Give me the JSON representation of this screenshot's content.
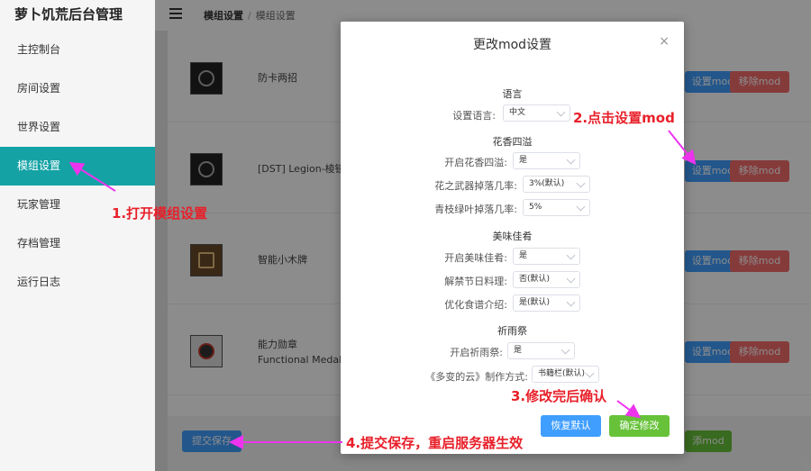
{
  "app": {
    "title": "萝卜饥荒后台管理"
  },
  "sidebar": {
    "items": [
      {
        "label": "主控制台",
        "active": false
      },
      {
        "label": "房间设置",
        "active": false
      },
      {
        "label": "世界设置",
        "active": false
      },
      {
        "label": "模组设置",
        "active": true
      },
      {
        "label": "玩家管理",
        "active": false
      },
      {
        "label": "存档管理",
        "active": false
      },
      {
        "label": "运行日志",
        "active": false
      }
    ]
  },
  "header": {
    "breadcrumb": [
      "模组设置",
      "模组设置"
    ],
    "separator": "/"
  },
  "mods": [
    {
      "name": "防卡两招",
      "set_label": "设置mod",
      "delete_label": "移除mod"
    },
    {
      "name": "[DST] Legion-棱镜",
      "set_label": "设置mod",
      "delete_label": "移除mod"
    },
    {
      "name": "智能小木牌",
      "set_label": "设置mod",
      "delete_label": "移除mod"
    },
    {
      "name": "能力勋章 Functional Medal",
      "set_label": "设置mod",
      "delete_label": "移除mod"
    }
  ],
  "footer": {
    "submit_label": "提交保存",
    "add_label": "添mod"
  },
  "dialog": {
    "title": "更改mod设置",
    "close_glyph": "×",
    "sections": [
      {
        "title": "语言",
        "fields": [
          {
            "label": "设置语言:",
            "value": "中文"
          }
        ]
      },
      {
        "title": "花香四溢",
        "fields": [
          {
            "label": "开启花香四溢:",
            "value": "是"
          },
          {
            "label": "花之武器掉落几率:",
            "value": "3%(默认)"
          },
          {
            "label": "青枝绿叶掉落几率:",
            "value": "5%"
          }
        ]
      },
      {
        "title": "美味佳肴",
        "fields": [
          {
            "label": "开启美味佳肴:",
            "value": "是"
          },
          {
            "label": "解禁节日料理:",
            "value": "否(默认)"
          },
          {
            "label": "优化食谱介绍:",
            "value": "是(默认)"
          }
        ]
      },
      {
        "title": "祈雨祭",
        "fields": [
          {
            "label": "开启祈雨祭:",
            "value": "是"
          },
          {
            "label": "《多变的云》制作方式:",
            "value": "书籍栏(默认)"
          }
        ]
      }
    ],
    "reset_label": "恢复默认",
    "confirm_label": "确定修改"
  },
  "annotations": {
    "step1": "1.打开模组设置",
    "step2": "2.点击设置mod",
    "step3": "3.修改完后确认",
    "step4": "4.提交保存，重启服务器生效"
  },
  "colors": {
    "sidebar_active": "#14a2a5",
    "primary": "#409eff",
    "danger": "#f56c6c",
    "success": "#67c23a",
    "annotation": "#e8202a",
    "arrow": "#ee33ee"
  }
}
